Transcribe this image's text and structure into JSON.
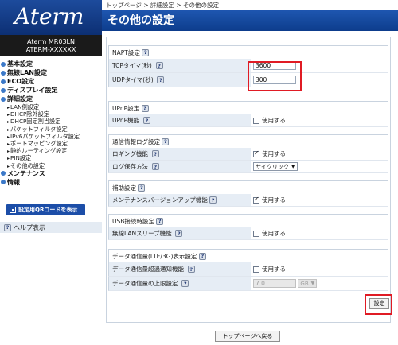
{
  "sidebar": {
    "logo": "Aterm",
    "model_line1": "Aterm MR03LN",
    "model_line2": "ATERM-XXXXXX",
    "nav": [
      {
        "label": "基本設定"
      },
      {
        "label": "無線LAN設定"
      },
      {
        "label": "ECO設定"
      },
      {
        "label": "ディスプレイ設定"
      },
      {
        "label": "詳細設定"
      }
    ],
    "sub_items": [
      "LAN側設定",
      "DHCP除外設定",
      "DHCP固定割当設定",
      "パケットフィルタ設定",
      "IPv6パケットフィルタ設定",
      "ポートマッピング設定",
      "静的ルーティング設定",
      "PIN設定",
      "その他の設定"
    ],
    "nav_bottom": [
      {
        "label": "メンテナンス"
      },
      {
        "label": "情報"
      }
    ],
    "qr_button": "設定用QRコードを表示",
    "help": "ヘルプ表示"
  },
  "breadcrumb": "トップページ > 詳細設定 > その他の設定",
  "page_title": "その他の設定",
  "help_glyph": "?",
  "sections": {
    "napt": {
      "title": "NAPT設定",
      "tcp_label": "TCPタイマ(秒)",
      "tcp_value": "3600",
      "udp_label": "UDPタイマ(秒)",
      "udp_value": "300"
    },
    "upnp": {
      "title": "UPnP設定",
      "func_label": "UPnP機能",
      "func_check": "使用する"
    },
    "log": {
      "title": "通信情報ログ設定",
      "logging_label": "ロギング機能",
      "logging_check": "使用する",
      "save_label": "ログ保存方法",
      "save_value": "サイクリック"
    },
    "assist": {
      "title": "補助設定",
      "maint_label": "メンテナンスバージョンアップ機能",
      "maint_check": "使用する"
    },
    "usb": {
      "title": "USB接続時設定",
      "sleep_label": "無線LANスリープ機能",
      "sleep_check": "使用する"
    },
    "data": {
      "title": "データ通信量(LTE/3G)表示設定",
      "notify_label": "データ通信量超過通知機能",
      "notify_check": "使用する",
      "limit_label": "データ通信量の上限設定",
      "limit_value": "7.0",
      "limit_unit": "GB"
    }
  },
  "apply_button": "設定",
  "back_button": "トップページへ戻る",
  "colors": {
    "brand": "#1d4b9c",
    "highlight": "#e01b24",
    "label_bg": "#e6edf5"
  }
}
